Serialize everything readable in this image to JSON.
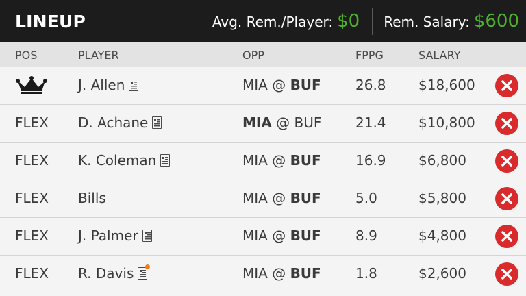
{
  "header": {
    "title": "LINEUP",
    "avg_label": "Avg. Rem./Player:",
    "avg_value": "$0",
    "rem_label": "Rem. Salary:",
    "rem_value": "$600"
  },
  "columns": {
    "pos": "POS",
    "player": "PLAYER",
    "opp": "OPP",
    "fppg": "FPPG",
    "salary": "SALARY"
  },
  "rows": [
    {
      "pos": "",
      "pos_icon": "captain-crown-icon",
      "player": "J. Allen",
      "news": true,
      "news_alert": false,
      "opp_away": "MIA",
      "opp_sep": " @ ",
      "opp_home": "BUF",
      "bold_side": "home",
      "fppg": "26.8",
      "salary": "$18,600"
    },
    {
      "pos": "FLEX",
      "player": "D. Achane",
      "news": true,
      "news_alert": false,
      "opp_away": "MIA",
      "opp_sep": " @ ",
      "opp_home": "BUF",
      "bold_side": "away",
      "fppg": "21.4",
      "salary": "$10,800"
    },
    {
      "pos": "FLEX",
      "player": "K. Coleman",
      "news": true,
      "news_alert": false,
      "opp_away": "MIA",
      "opp_sep": " @ ",
      "opp_home": "BUF",
      "bold_side": "home",
      "fppg": "16.9",
      "salary": "$6,800"
    },
    {
      "pos": "FLEX",
      "player": "Bills",
      "news": false,
      "news_alert": false,
      "opp_away": "MIA",
      "opp_sep": " @ ",
      "opp_home": "BUF",
      "bold_side": "home",
      "fppg": "5.0",
      "salary": "$5,800"
    },
    {
      "pos": "FLEX",
      "player": "J. Palmer",
      "news": true,
      "news_alert": false,
      "opp_away": "MIA",
      "opp_sep": " @ ",
      "opp_home": "BUF",
      "bold_side": "home",
      "fppg": "8.9",
      "salary": "$4,800"
    },
    {
      "pos": "FLEX",
      "player": "R. Davis",
      "news": true,
      "news_alert": true,
      "opp_away": "MIA",
      "opp_sep": " @ ",
      "opp_home": "BUF",
      "bold_side": "home",
      "fppg": "1.8",
      "salary": "$2,600"
    }
  ],
  "colors": {
    "accent_green": "#4fb02c",
    "remove_red": "#d92b2b",
    "news_alert_orange": "#f07d1a",
    "header_bg": "#1c1c1c"
  }
}
